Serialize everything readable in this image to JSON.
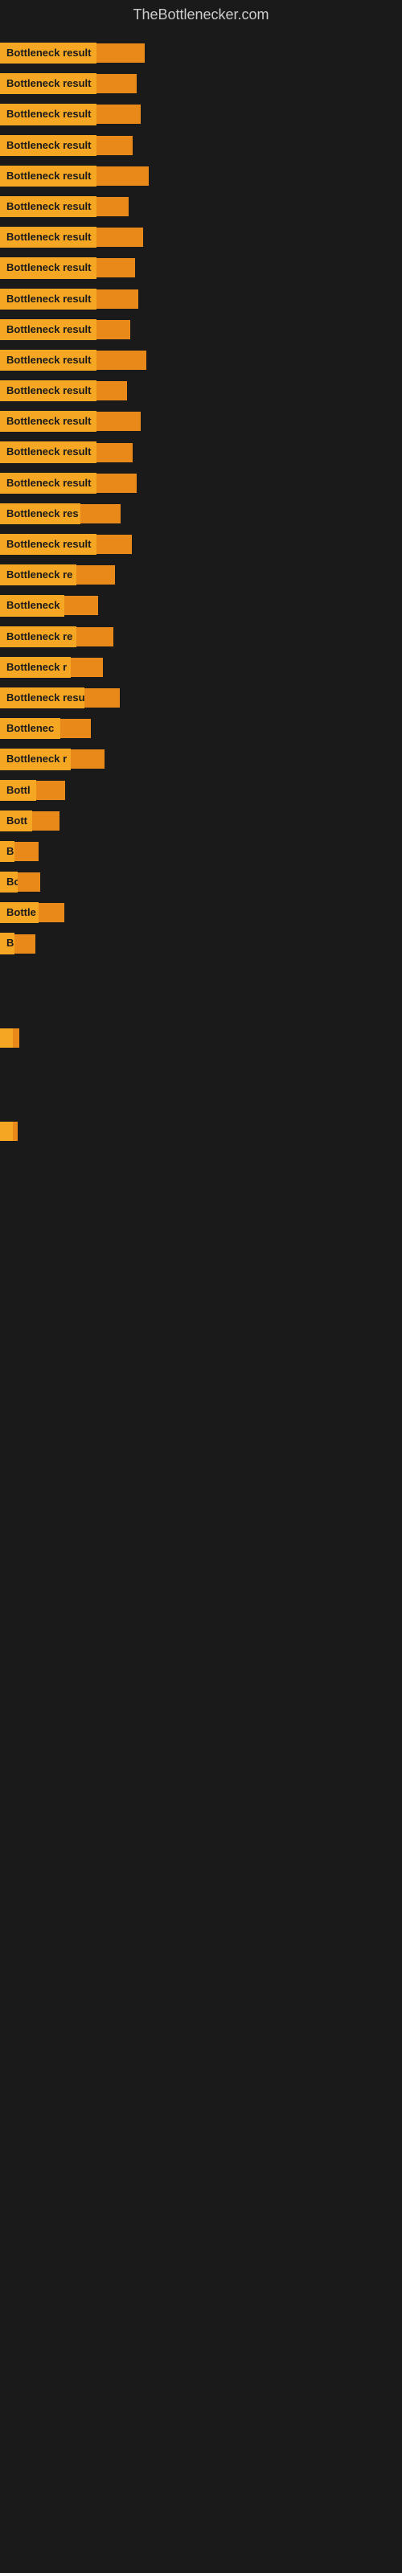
{
  "header": {
    "title": "TheBottlenecker.com"
  },
  "bars": [
    {
      "label": "Bottleneck result",
      "label_width": 120,
      "ext_width": 60
    },
    {
      "label": "Bottleneck result",
      "label_width": 120,
      "ext_width": 50
    },
    {
      "label": "Bottleneck result",
      "label_width": 120,
      "ext_width": 55
    },
    {
      "label": "Bottleneck result",
      "label_width": 120,
      "ext_width": 45
    },
    {
      "label": "Bottleneck result",
      "label_width": 120,
      "ext_width": 65
    },
    {
      "label": "Bottleneck result",
      "label_width": 120,
      "ext_width": 40
    },
    {
      "label": "Bottleneck result",
      "label_width": 120,
      "ext_width": 58
    },
    {
      "label": "Bottleneck result",
      "label_width": 120,
      "ext_width": 48
    },
    {
      "label": "Bottleneck result",
      "label_width": 120,
      "ext_width": 52
    },
    {
      "label": "Bottleneck result",
      "label_width": 120,
      "ext_width": 42
    },
    {
      "label": "Bottleneck result",
      "label_width": 120,
      "ext_width": 62
    },
    {
      "label": "Bottleneck result",
      "label_width": 120,
      "ext_width": 38
    },
    {
      "label": "Bottleneck result",
      "label_width": 120,
      "ext_width": 55
    },
    {
      "label": "Bottleneck result",
      "label_width": 120,
      "ext_width": 45
    },
    {
      "label": "Bottleneck result",
      "label_width": 120,
      "ext_width": 50
    },
    {
      "label": "Bottleneck res",
      "label_width": 100,
      "ext_width": 50
    },
    {
      "label": "Bottleneck result",
      "label_width": 120,
      "ext_width": 44
    },
    {
      "label": "Bottleneck re",
      "label_width": 95,
      "ext_width": 48
    },
    {
      "label": "Bottleneck",
      "label_width": 80,
      "ext_width": 42
    },
    {
      "label": "Bottleneck re",
      "label_width": 95,
      "ext_width": 46
    },
    {
      "label": "Bottleneck r",
      "label_width": 88,
      "ext_width": 40
    },
    {
      "label": "Bottleneck resu",
      "label_width": 105,
      "ext_width": 44
    },
    {
      "label": "Bottlenec",
      "label_width": 75,
      "ext_width": 38
    },
    {
      "label": "Bottleneck r",
      "label_width": 88,
      "ext_width": 42
    },
    {
      "label": "Bottl",
      "label_width": 45,
      "ext_width": 36
    },
    {
      "label": "Bott",
      "label_width": 40,
      "ext_width": 34
    },
    {
      "label": "B",
      "label_width": 18,
      "ext_width": 30
    },
    {
      "label": "Bo",
      "label_width": 22,
      "ext_width": 28
    },
    {
      "label": "Bottle",
      "label_width": 48,
      "ext_width": 32
    },
    {
      "label": "B",
      "label_width": 18,
      "ext_width": 26
    },
    {
      "label": "",
      "label_width": 0,
      "ext_width": 0
    },
    {
      "label": "",
      "label_width": 0,
      "ext_width": 0
    },
    {
      "label": "",
      "label_width": 0,
      "ext_width": 8
    },
    {
      "label": "",
      "label_width": 0,
      "ext_width": 0
    },
    {
      "label": "",
      "label_width": 0,
      "ext_width": 0
    },
    {
      "label": "",
      "label_width": 0,
      "ext_width": 6
    }
  ]
}
